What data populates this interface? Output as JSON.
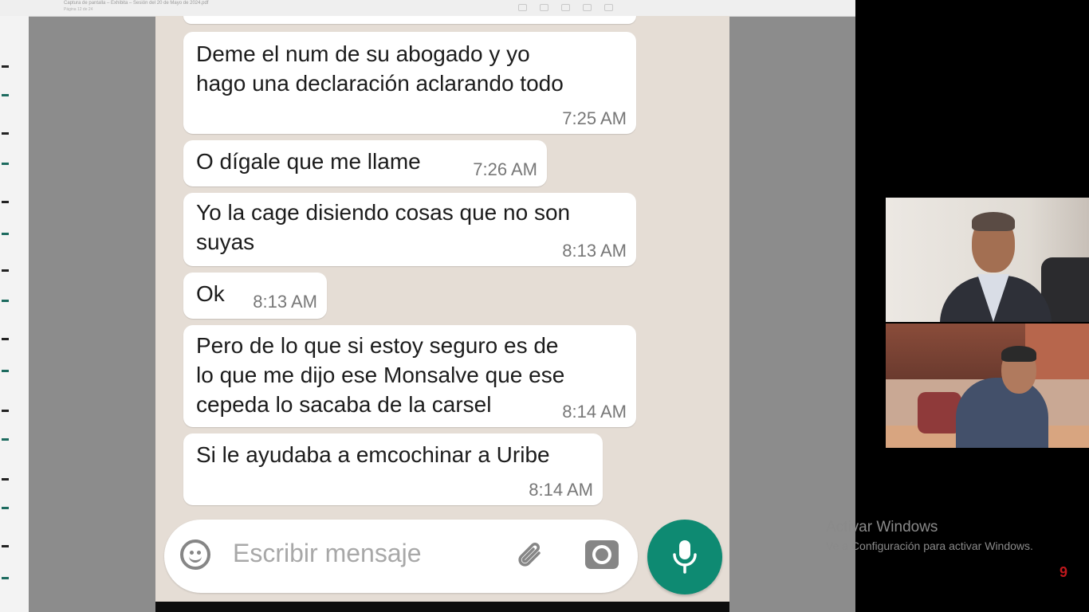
{
  "viewer": {
    "doc_title": "Captura de pantalla – Exhibita – Sesión del 20 de Mayo de 2024.pdf",
    "doc_subtitle": "Página 12 de 24"
  },
  "chat": {
    "messages": [
      {
        "lines": [
          "Deme el num de su abogado y yo",
          "hago una declaración aclarando todo"
        ],
        "time": "7:25 AM"
      },
      {
        "lines": [
          "O dígale que me llame"
        ],
        "time": "7:26 AM"
      },
      {
        "lines": [
          "Yo la cage disiendo cosas que no son",
          "suyas"
        ],
        "time": "8:13 AM"
      },
      {
        "lines": [
          "Ok"
        ],
        "time": "8:13 AM"
      },
      {
        "lines": [
          "Pero de lo que si estoy seguro es de",
          "lo que me dijo ese Monsalve que ese",
          "cepeda lo sacaba de la carsel"
        ],
        "time": "8:14 AM"
      },
      {
        "lines": [
          "Si le ayudaba a emcochinar a Uribe"
        ],
        "time": "8:14 AM"
      }
    ],
    "composer": {
      "placeholder": "Escribir mensaje",
      "icons": [
        "emoji-icon",
        "paperclip-icon",
        "camera-icon",
        "microphone-icon"
      ]
    },
    "colors": {
      "background": "#e5ddd5",
      "bubble": "#ffffff",
      "accent": "#0e8a72"
    }
  },
  "windows_notice": {
    "title": "Activar Windows",
    "subtitle": "Ve a Configuración para activar Windows."
  }
}
